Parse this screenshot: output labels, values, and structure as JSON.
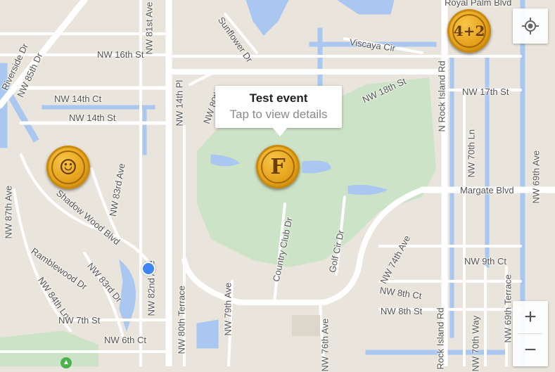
{
  "info_window": {
    "title": "Test event",
    "subtitle": "Tap to view details"
  },
  "markers": [
    {
      "name": "smiley-marker",
      "glyph": "☺"
    },
    {
      "name": "f-marker",
      "glyph": "F"
    },
    {
      "name": "four-plus-two-marker",
      "glyph": "4+2"
    }
  ],
  "controls": {
    "locate_icon": "my-location-icon",
    "zoom_in_label": "+",
    "zoom_out_label": "−"
  },
  "streets": {
    "royal_palm": "Royal Palm Blvd",
    "sunflower": "Sunflower Dr",
    "viscaya": "Viscaya Cir",
    "riverside": "Riverside Dr",
    "nw85th": "NW 85th Dr",
    "nw81st": "NW 81st Ave",
    "nw16th": "NW 16th St",
    "nw14thct": "NW 14th Ct",
    "nw14thst": "NW 14th St",
    "nw14thpl": "NW 14th Pl",
    "nw80th": "NW 80th",
    "nw18th": "NW 18th St",
    "n_rock_island": "N Rock Island Rd",
    "nw17th": "NW 17th St",
    "nw70thln": "NW 70th Ln",
    "nw69th": "NW 69th Ave",
    "nw87th": "NW 87th Ave",
    "shadow_wood": "Shadow Wood Blvd",
    "nw83rd": "NW 83rd Ave",
    "margate": "Margate Blvd",
    "country_club": "Country Club Dr",
    "golf_cir": "Golf Cir Dr",
    "nw74th": "NW 74th Ave",
    "ramblewood": "Ramblewood Dr",
    "nw83rd_dr": "NW 83rd Dr",
    "nw82nd": "NW 82nd Ave",
    "nw9thct": "NW 9th Ct",
    "nw84thln": "NW 84th Ln",
    "nw8thct": "NW 8th Ct",
    "nw8thst": "NW 8th St",
    "nw7thst": "NW 7th St",
    "nw80thterr": "NW 80th Terrace",
    "nw79th": "NW 79th Ave",
    "nw76th": "NW 76th Ave",
    "rock_island_low": "Rock Island Rd",
    "nw70thway": "NW 70th Way",
    "nw69thterr": "NW 69th Terrace",
    "nw6thct": "NW 6th Ct"
  }
}
